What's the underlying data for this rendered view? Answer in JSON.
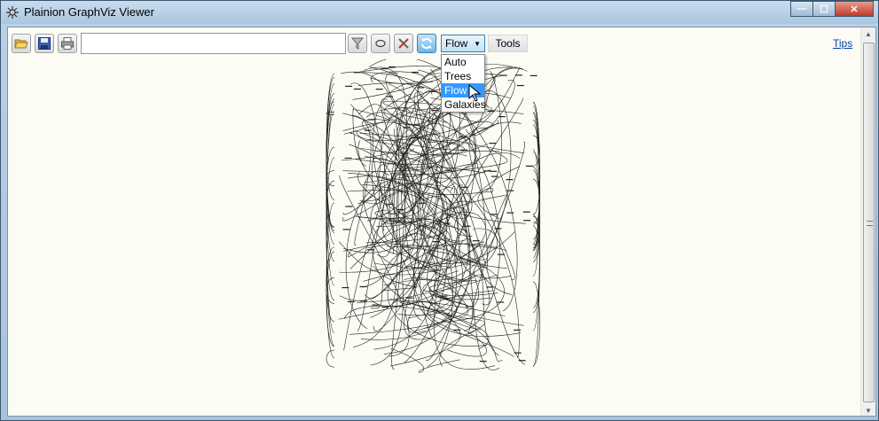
{
  "window": {
    "title": "Plainion GraphViz Viewer"
  },
  "toolbar": {
    "open_icon": "folder-open-icon",
    "save_icon": "floppy-disk-icon",
    "print_icon": "printer-icon",
    "search": {
      "value": "",
      "placeholder": ""
    },
    "filter_icon": "filter-icon",
    "ellipse_icon": "ellipse-icon",
    "settings_icon": "tools-icon",
    "refresh_icon": "refresh-icon",
    "layout": {
      "selected": "Flow",
      "options": [
        "Auto",
        "Trees",
        "Flow",
        "Galaxies"
      ]
    },
    "tools_label": "Tools",
    "tips_label": "Tips"
  },
  "colors": {
    "background": "#fcfcf4",
    "selection": "#3399ff",
    "link": "#0645ad"
  }
}
